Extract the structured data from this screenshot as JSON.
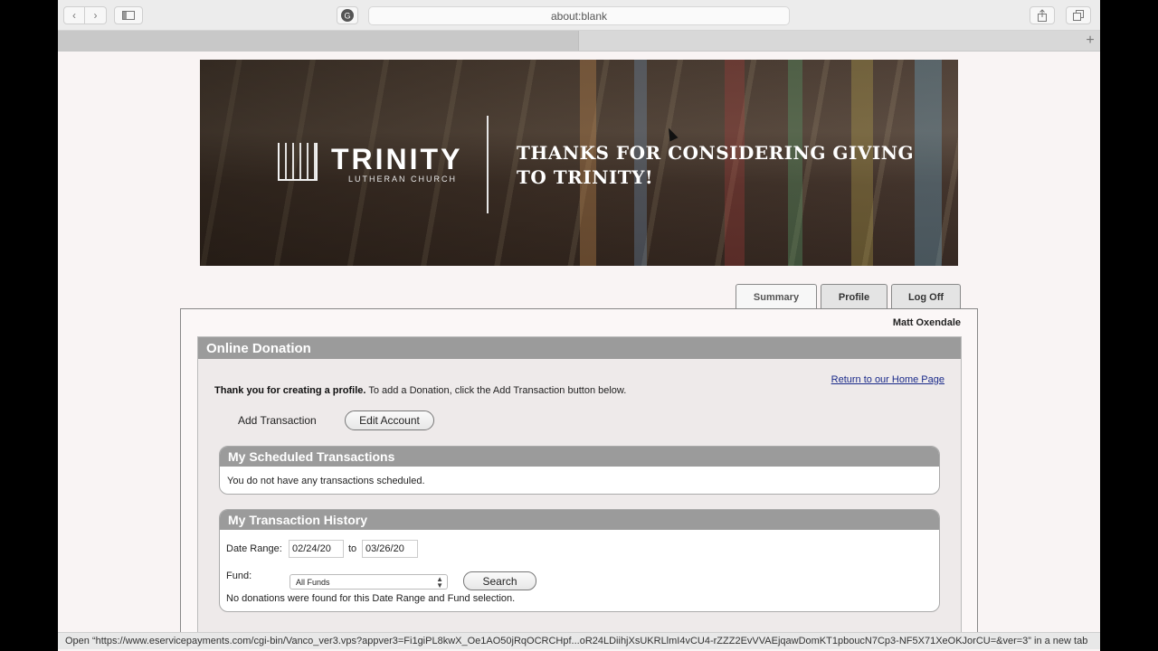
{
  "browser": {
    "address": "about:blank",
    "status_text": "Open “https://www.eservicepayments.com/cgi-bin/Vanco_ver3.vps?appver3=Fi1giPL8kwX_Oe1AO50jRqOCRCHpf...oR24LDiihjXsUKRLlmI4vCU4-rZZZ2EvVVAEjqawDomKT1pboucN7Cp3-NF5X71XeOKJorCU=&ver=3” in a new tab"
  },
  "banner": {
    "church_name": "TRINITY",
    "church_sub": "LUTHERAN CHURCH",
    "tagline": "THANKS FOR CONSIDERING GIVING TO TRINITY!"
  },
  "tabs": [
    {
      "label": "Summary"
    },
    {
      "label": "Profile"
    },
    {
      "label": "Log Off"
    }
  ],
  "user": {
    "name": "Matt Oxendale"
  },
  "donation": {
    "title": "Online Donation",
    "home_link": "Return to our Home Page",
    "intro_bold": "Thank you for creating a profile.",
    "intro_rest": " To add a Donation, click the Add Transaction button below.",
    "add_transaction": "Add Transaction",
    "edit_account": "Edit Account"
  },
  "scheduled": {
    "title": "My Scheduled Transactions",
    "message": "You do not have any transactions scheduled."
  },
  "history": {
    "title": "My Transaction History",
    "date_range_label": "Date Range:",
    "from_date": "02/24/20",
    "to_label": "to",
    "to_date": "03/26/20",
    "fund_label": "Fund:",
    "fund_selected": "All Funds",
    "search_label": "Search",
    "message": "No donations were found for this Date Range and Fund selection."
  }
}
